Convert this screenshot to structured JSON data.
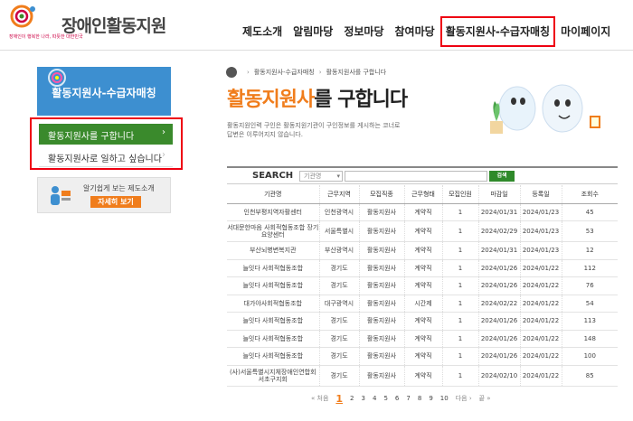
{
  "brand": {
    "title": "장애인활동지원",
    "tagline1": "장애인이 행복한 나라, 따뜻한 대한민국",
    "tagline2": "따뜻한 대한민국",
    "colors": {
      "blue": "#3d8fd0",
      "green": "#3a8a2c",
      "orange": "#f07d1c",
      "highlight": "#e01"
    }
  },
  "gnb": [
    "제도소개",
    "알림마당",
    "정보마당",
    "참여마당",
    "활동지원사-수급자매칭",
    "마이페이지"
  ],
  "sidebar": {
    "banner_title": "활동지원사-수급자매칭",
    "items": [
      {
        "label": "활동지원사를 구합니다"
      },
      {
        "label": "활동지원사로 일하고 싶습니다"
      }
    ],
    "guide": {
      "text": "알기쉽게 보는 제도소개",
      "button": "자세히 보기"
    }
  },
  "breadcrumb": [
    "활동지원사-수급자매칭",
    "활동지원사를 구합니다"
  ],
  "page": {
    "title_accent": "활동지원사",
    "title_rest": "를 구합니다",
    "desc1": "활동지원인력 구인은 활동지원기관이 구인정보를 게시하는 코너로",
    "desc2": "답변은 이루어지지 않습니다."
  },
  "search": {
    "label": "SEARCH",
    "select_value": "기관명",
    "button": "검색"
  },
  "table": {
    "headers": [
      "기관명",
      "근무지역",
      "모집직종",
      "근무형태",
      "모집인원",
      "마감일",
      "등록일",
      "조회수"
    ],
    "rows": [
      [
        "인천부평지역자활센터",
        "인천광역시",
        "활동지원사",
        "계약직",
        "1",
        "2024/01/31",
        "2024/01/23",
        "45"
      ],
      [
        "서대문한마음 사회적협동조합 장기요양센터",
        "서울특별시",
        "활동지원사",
        "계약직",
        "1",
        "2024/02/29",
        "2024/01/23",
        "53"
      ],
      [
        "부산뇌병변복지관",
        "부산광역시",
        "활동지원사",
        "계약직",
        "1",
        "2024/01/31",
        "2024/01/23",
        "12"
      ],
      [
        "늘잇다 사회적협동조합",
        "경기도",
        "활동지원사",
        "계약직",
        "1",
        "2024/01/26",
        "2024/01/22",
        "112"
      ],
      [
        "늘잇다 사회적협동조합",
        "경기도",
        "활동지원사",
        "계약직",
        "1",
        "2024/01/26",
        "2024/01/22",
        "76"
      ],
      [
        "대가야사회적협동조합",
        "대구광역시",
        "활동지원사",
        "시간제",
        "1",
        "2024/02/22",
        "2024/01/22",
        "54"
      ],
      [
        "늘잇다 사회적협동조합",
        "경기도",
        "활동지원사",
        "계약직",
        "1",
        "2024/01/26",
        "2024/01/22",
        "113"
      ],
      [
        "늘잇다 사회적협동조합",
        "경기도",
        "활동지원사",
        "계약직",
        "1",
        "2024/01/26",
        "2024/01/22",
        "148"
      ],
      [
        "늘잇다 사회적협동조합",
        "경기도",
        "활동지원사",
        "계약직",
        "1",
        "2024/01/26",
        "2024/01/22",
        "100"
      ],
      [
        "(사)서울특별시지체장애인연합회 서초구지회",
        "경기도",
        "활동지원사",
        "계약직",
        "1",
        "2024/02/10",
        "2024/01/22",
        "85"
      ]
    ]
  },
  "pager": {
    "first": "« 처음",
    "pages": [
      "1",
      "2",
      "3",
      "4",
      "5",
      "6",
      "7",
      "8",
      "9",
      "10"
    ],
    "current": "1",
    "next": "다음 ›",
    "last": "끝 »"
  }
}
